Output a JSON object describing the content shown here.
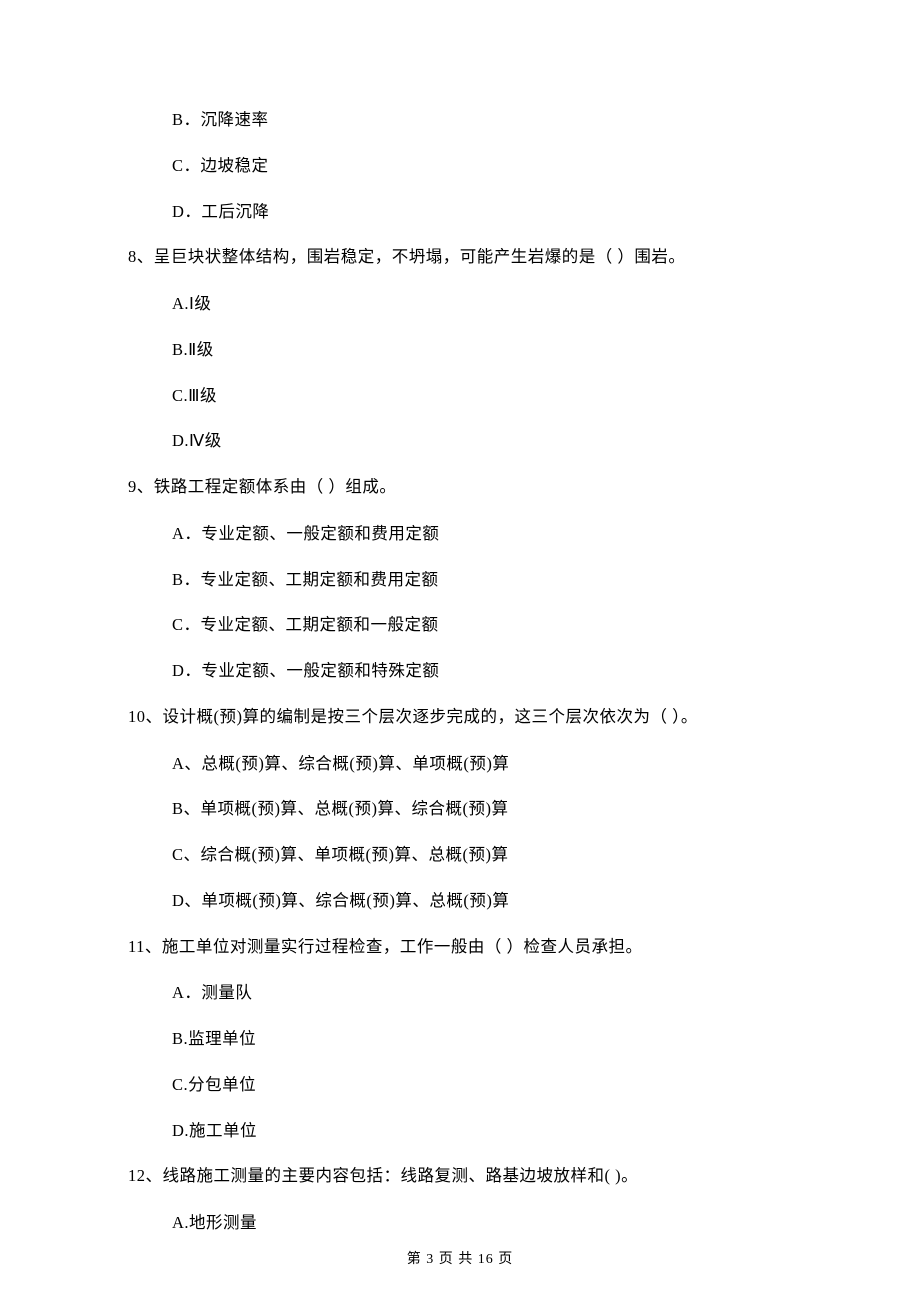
{
  "orphan_options": {
    "b": "B．沉降速率",
    "c": "C．边坡稳定",
    "d": "D．工后沉降"
  },
  "q8": {
    "text": "8、呈巨块状整体结构，围岩稳定，不坍塌，可能产生岩爆的是（    ）围岩。",
    "a": "A.Ⅰ级",
    "b": "B.Ⅱ级",
    "c": "C.Ⅲ级",
    "d": "D.Ⅳ级"
  },
  "q9": {
    "text": "9、铁路工程定额体系由（    ）组成。",
    "a": "A．专业定额、一般定额和费用定额",
    "b": "B．专业定额、工期定额和费用定额",
    "c": "C．专业定额、工期定额和一般定额",
    "d": "D．专业定额、一般定额和特殊定额"
  },
  "q10": {
    "text": "10、设计概(预)算的编制是按三个层次逐步完成的，这三个层次依次为（    ）。",
    "a": "A、总概(预)算、综合概(预)算、单项概(预)算",
    "b": "B、单项概(预)算、总概(预)算、综合概(预)算",
    "c": "C、综合概(预)算、单项概(预)算、总概(预)算",
    "d": "D、单项概(预)算、综合概(预)算、总概(预)算"
  },
  "q11": {
    "text": "11、施工单位对测量实行过程检查，工作一般由（    ）检查人员承担。",
    "a": "A．测量队",
    "b": "B.监理单位",
    "c": "C.分包单位",
    "d": "D.施工单位"
  },
  "q12": {
    "text": "12、线路施工测量的主要内容包括：线路复测、路基边坡放样和(     )。",
    "a": "A.地形测量"
  },
  "footer": "第 3 页 共 16 页"
}
